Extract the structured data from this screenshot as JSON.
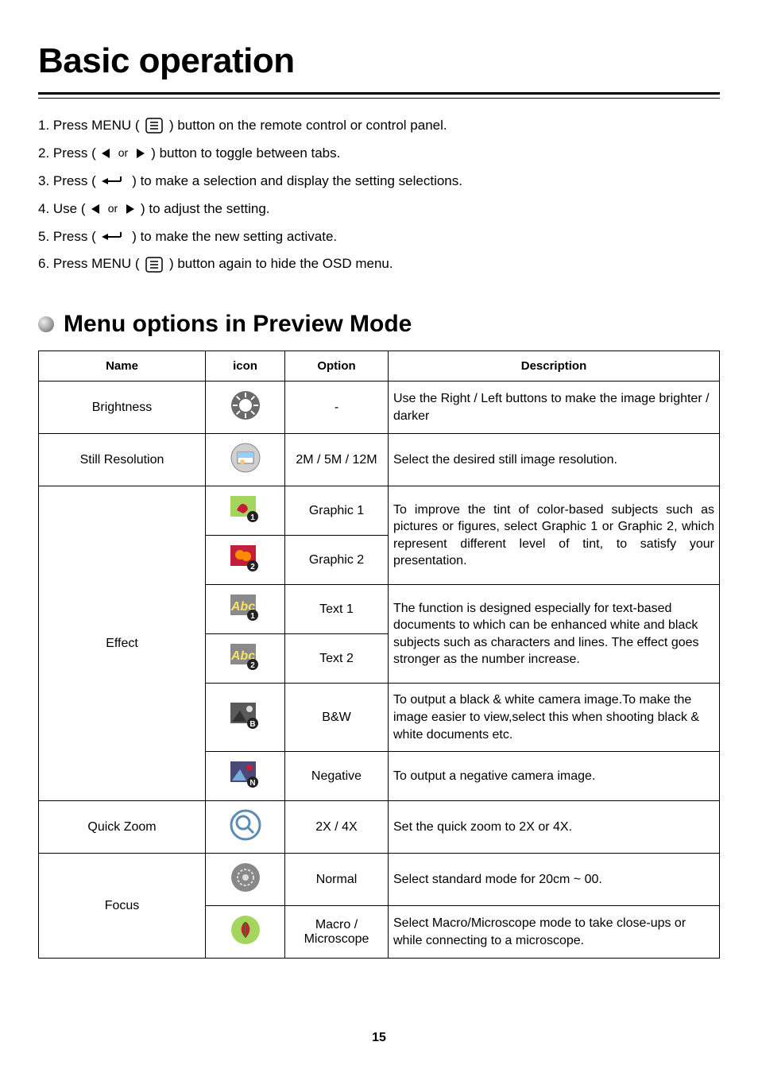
{
  "page_title": "Basic operation",
  "steps": [
    {
      "before": "1. Press MENU ( ",
      "icon": "menu-icon",
      "after": " ) button on the remote control or control panel."
    },
    {
      "before": "2. Press ( ",
      "icon": "left-right-arrows",
      "after": " ) button to toggle between tabs."
    },
    {
      "before": "3. Press ( ",
      "icon": "enter-icon",
      "after": " ) to make a selection and display the setting selections."
    },
    {
      "before": "4. Use ( ",
      "icon": "left-right-arrows",
      "after": " ) to adjust the setting."
    },
    {
      "before": "5. Press ( ",
      "icon": "enter-icon",
      "after": " ) to make the new setting activate."
    },
    {
      "before": "6. Press MENU ( ",
      "icon": "menu-icon",
      "after": " ) button again to hide the OSD menu."
    }
  ],
  "section_title": "Menu options in Preview Mode",
  "table": {
    "headers": [
      "Name",
      "icon",
      "Option",
      "Description"
    ],
    "rows": [
      {
        "name": "Brightness",
        "name_rowspan": 1,
        "icon": "brightness",
        "option": "-",
        "desc": "Use the Right / Left buttons to make the image brighter / darker",
        "desc_rowspan": 1
      },
      {
        "name": "Still Resolution",
        "name_rowspan": 1,
        "icon": "resolution",
        "option": "2M / 5M / 12M",
        "desc": "Select the desired still image resolution.",
        "desc_rowspan": 1
      },
      {
        "name": "Effect",
        "name_rowspan": 6,
        "icon": "graphic1",
        "option": "Graphic 1",
        "desc": "To improve the tint of color-based subjects such as pictures or figures, select Graphic 1 or Graphic 2, which represent different level of tint, to satisfy your presentation.",
        "desc_rowspan": 2
      },
      {
        "icon": "graphic2",
        "option": "Graphic 2"
      },
      {
        "icon": "text1",
        "option": "Text 1",
        "desc": "The function is designed especially for text-based documents to which can be enhanced white and black subjects such as characters and lines. The effect goes stronger as the number increase.",
        "desc_rowspan": 2
      },
      {
        "icon": "text2",
        "option": "Text 2"
      },
      {
        "icon": "bw",
        "option": "B&W",
        "desc": "To output a black & white camera image.To make the image easier to view,select this when shooting black & white documents etc.",
        "desc_rowspan": 1
      },
      {
        "icon": "negative",
        "option": "Negative",
        "desc": "To output a negative camera image.",
        "desc_rowspan": 1
      },
      {
        "name": "Quick Zoom",
        "name_rowspan": 1,
        "icon": "zoom",
        "option": "2X / 4X",
        "desc": "Set the quick zoom to 2X or 4X.",
        "desc_rowspan": 1
      },
      {
        "name": "Focus",
        "name_rowspan": 2,
        "icon": "focus",
        "option": "Normal",
        "desc": "Select standard mode for 20cm ~ 00.",
        "desc_rowspan": 1
      },
      {
        "icon": "macro",
        "option": "Macro / Microscope",
        "desc": "Select Macro/Microscope mode to take close-ups or while connecting to a microscope.",
        "desc_rowspan": 1
      }
    ]
  },
  "page_number": "15"
}
